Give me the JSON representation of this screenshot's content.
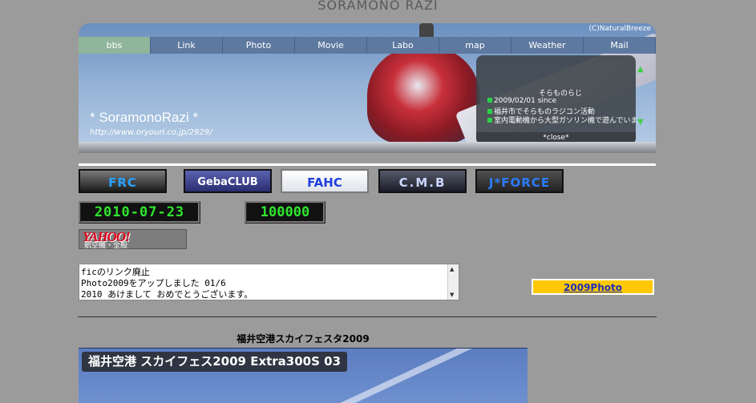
{
  "site": {
    "title": "SORAMONO RAZI"
  },
  "banner": {
    "copyright": "(C)NaturalBreeze",
    "name": "* SoramonoRazi *",
    "url": "http://www.oryouri.co.jp/2929/",
    "nav": [
      "bbs",
      "Link",
      "Photo",
      "Movie",
      "Labo",
      "map",
      "Weather",
      "Mail"
    ],
    "info": {
      "title": "そらものらじ",
      "lines": [
        "2009/02/01  since",
        "福井市でそらものラジコン活動",
        "室内電動機から大型ガソリン機で遊んでいま"
      ],
      "close": "*close*"
    }
  },
  "links": [
    "FRC",
    "GebaCLUB",
    "FAHC",
    "C.M.B",
    "J*FORCE"
  ],
  "counters": {
    "date": "2010-07-23",
    "hits": "100000"
  },
  "yahoo": {
    "logo": "YAHOO!",
    "sub": "航空機・全般"
  },
  "notice": {
    "lines": [
      "ficのリンク廃止",
      "Photo2009をアップしました  01/6",
      "2010 あけまして  おめでとうございます。"
    ]
  },
  "photo_link": "2009Photo",
  "section": {
    "title": "福井空港スカイフェスタ2009",
    "caption": "福井空港  スカイフェス2009  Extra300S  03"
  }
}
